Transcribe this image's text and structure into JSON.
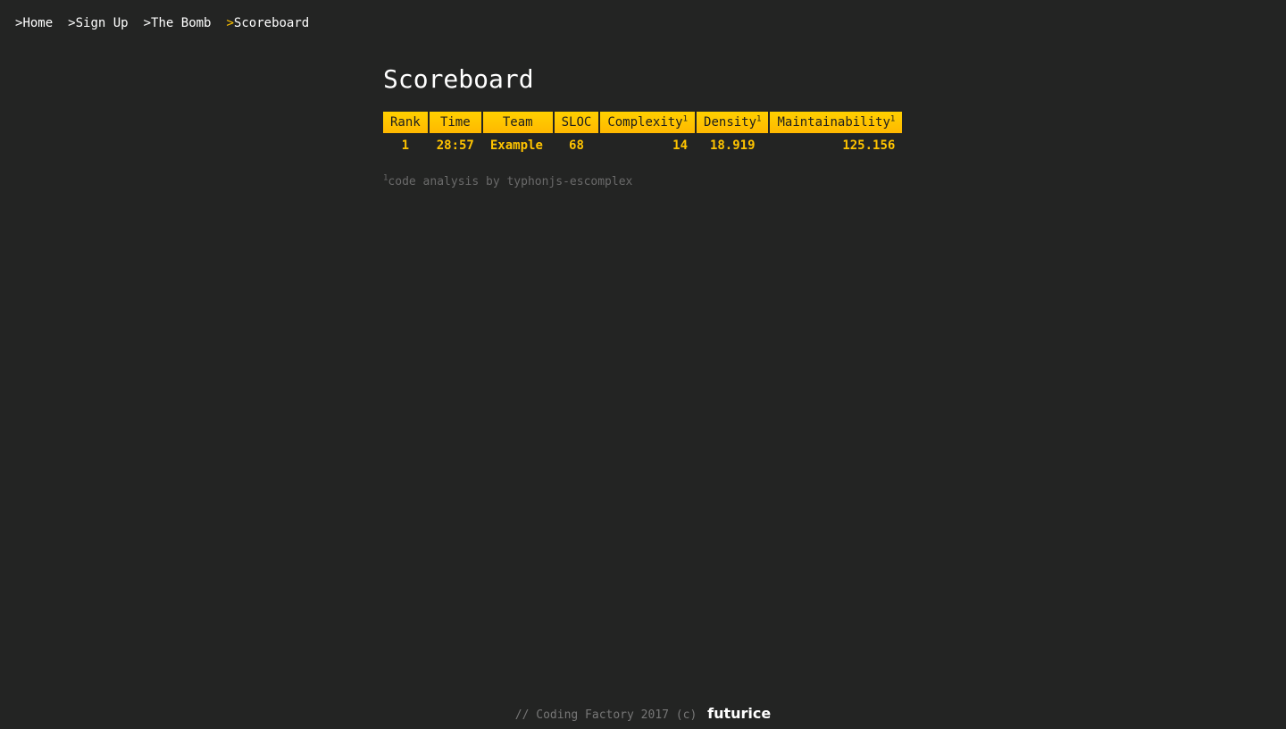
{
  "nav": {
    "prefix": ">",
    "items": [
      {
        "label": "Home"
      },
      {
        "label": "Sign Up"
      },
      {
        "label": "The Bomb"
      },
      {
        "label": "Scoreboard",
        "active": true
      }
    ]
  },
  "page": {
    "title": "Scoreboard"
  },
  "table": {
    "headers": [
      {
        "label": "Rank",
        "sup": ""
      },
      {
        "label": "Time",
        "sup": ""
      },
      {
        "label": "Team",
        "sup": ""
      },
      {
        "label": "SLOC",
        "sup": ""
      },
      {
        "label": "Complexity",
        "sup": "1"
      },
      {
        "label": "Density",
        "sup": "1"
      },
      {
        "label": "Maintainability",
        "sup": "1"
      }
    ],
    "rows": [
      [
        "1",
        "28:57",
        "Example",
        "68",
        "14",
        "18.919",
        "125.156"
      ]
    ]
  },
  "footnote": {
    "sup": "1",
    "text": "code analysis by typhonjs-escomplex"
  },
  "footer": {
    "text": "// Coding Factory 2017 (c)",
    "brand": "futurice"
  },
  "colors": {
    "background": "#232423",
    "accent": "#ffc400",
    "header_gradient_top": "#ffd100",
    "header_gradient_bottom": "#ffb800"
  }
}
